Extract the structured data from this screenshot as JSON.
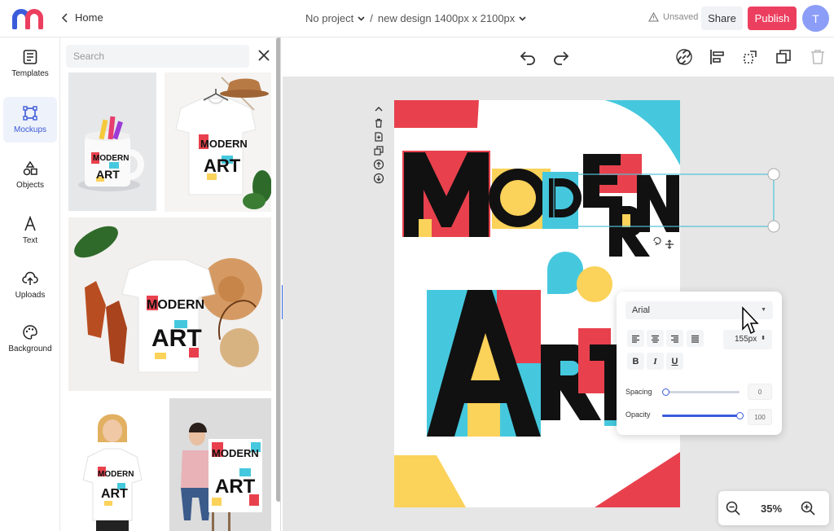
{
  "header": {
    "home_label": "Home",
    "project_label": "No project",
    "separator": "/",
    "design_label": "new design 1400px x 2100px",
    "status_label": "Unsaved",
    "share_label": "Share",
    "publish_label": "Publish",
    "avatar_initial": "T",
    "publish_color": "#ec3f5f"
  },
  "nav": {
    "items": [
      {
        "label": "Templates",
        "icon": "templates-icon"
      },
      {
        "label": "Mockups",
        "icon": "mockups-icon",
        "active": true
      },
      {
        "label": "Objects",
        "icon": "objects-icon"
      },
      {
        "label": "Text",
        "icon": "text-icon"
      },
      {
        "label": "Uploads",
        "icon": "uploads-icon"
      },
      {
        "label": "Background",
        "icon": "background-icon"
      }
    ]
  },
  "panel": {
    "search_placeholder": "Search",
    "mockups": [
      {
        "name": "mug-mockup",
        "art_line1": "MODERN",
        "art_line2": "ART"
      },
      {
        "name": "tshirt-hanger-mockup",
        "art_line1": "MODERN",
        "art_line2": "ART"
      },
      {
        "name": "tshirt-flatlay-mockup",
        "art_line1": "MODERN",
        "art_line2": "ART"
      },
      {
        "name": "woman-tshirt-mockup",
        "art_line1": "MODERN",
        "art_line2": "ART"
      },
      {
        "name": "woman-poster-mockup",
        "art_line1": "MODERN",
        "art_line2": "ART"
      }
    ]
  },
  "design": {
    "word1_letters": [
      "M",
      "O",
      "D",
      "E",
      "R",
      "N"
    ],
    "word2_letters": [
      "A",
      "R",
      "T"
    ],
    "colors": {
      "red": "#e8414d",
      "cyan": "#45c8de",
      "yellow": "#fbd25a",
      "black": "#111111"
    }
  },
  "font_panel": {
    "font_family": "Arial",
    "font_size": "155px",
    "bold_label": "B",
    "italic_label": "I",
    "underline_label": "U",
    "spacing_label": "Spacing",
    "spacing_value": "0",
    "spacing_fraction": 0.0,
    "opacity_label": "Opacity",
    "opacity_value": "100",
    "opacity_fraction": 1.0
  },
  "zoom": {
    "value": "35%"
  }
}
